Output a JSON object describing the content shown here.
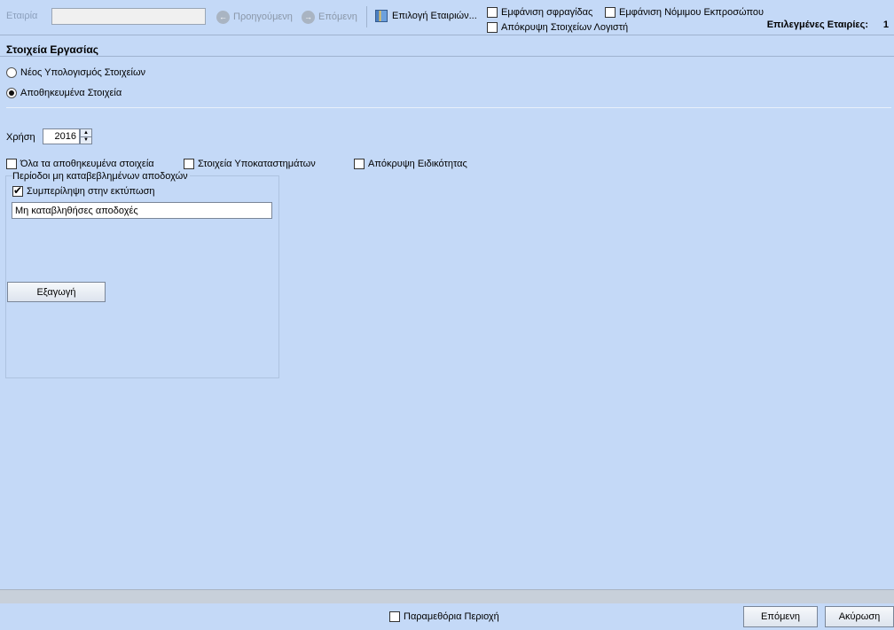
{
  "toolbar": {
    "company_label": "Εταιρία",
    "company_value": "",
    "prev_label": "Προηγούμενη",
    "next_label": "Επόμενη",
    "select_companies_label": "Επιλογή Εταιριών...",
    "show_stamp_label": "Εμφάνιση σφραγίδας",
    "hide_accountant_label": "Απόκρυψη Στοιχείων Λογιστή",
    "show_legal_rep_label": "Εμφάνιση Νόμιμου Εκπροσώπου",
    "selected_companies_label": "Επιλεγμένες Εταιρίες:",
    "selected_companies_count": "1"
  },
  "section": {
    "title": "Στοιχεία Εργασίας",
    "radio_new_label": "Νέος Υπολογισμός Στοιχείων",
    "radio_saved_label": "Αποθηκευμένα Στοιχεία"
  },
  "year": {
    "label": "Χρήση",
    "value": "2016"
  },
  "options": {
    "all_saved_label": "Όλα τα αποθηκευμένα στοιχεία",
    "branch_data_label": "Στοιχεία Υποκαταστημάτων",
    "hide_specialty_label": "Απόκρυψη Ειδικότητας"
  },
  "unpaid_group": {
    "title": "Περίοδοι μη καταβεβλημένων αποδοχών",
    "include_print_label": "Συμπερίληψη στην εκτύπωση",
    "text_value": "Μη καταβληθήσες αποδοχές",
    "export_label": "Εξαγωγή"
  },
  "footer": {
    "parameter_area_label": "Παραμεθόρια Περιοχή",
    "next_button": "Επόμενη",
    "cancel_button": "Ακύρωση"
  }
}
